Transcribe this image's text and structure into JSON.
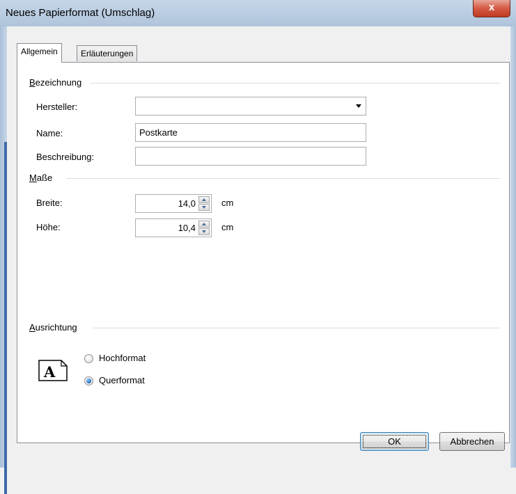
{
  "window": {
    "title": "Neues Papierformat (Umschlag)",
    "close_glyph": "x"
  },
  "tabs": [
    {
      "label": "Allgemein",
      "active": true
    },
    {
      "label": "Erläuterungen",
      "active": false
    }
  ],
  "bezeichnung": {
    "section_label_first": "B",
    "section_label_rest": "ezeichnung",
    "hersteller_label": "Hersteller:",
    "hersteller_value": "",
    "name_label": "Name:",
    "name_value": "Postkarte",
    "beschreibung_label": "Beschreibung:",
    "beschreibung_value": ""
  },
  "masse": {
    "section_label_first": "M",
    "section_label_rest": "aße",
    "breite_label": "Breite:",
    "breite_value": "14,0",
    "breite_unit": "cm",
    "hoehe_label": "Höhe:",
    "hoehe_value": "10,4",
    "hoehe_unit": "cm"
  },
  "ausrichtung": {
    "section_label_first": "A",
    "section_label_rest": "usrichtung",
    "icon_letter": "A",
    "options": [
      {
        "label": "Hochformat",
        "checked": false
      },
      {
        "label": "Querformat",
        "checked": true
      }
    ]
  },
  "buttons": {
    "ok": "OK",
    "cancel": "Abbrechen"
  },
  "colors": {
    "title_bar": "#b8cbe0",
    "close_button": "#c03a22",
    "radio_accent": "#1c5fb8"
  }
}
